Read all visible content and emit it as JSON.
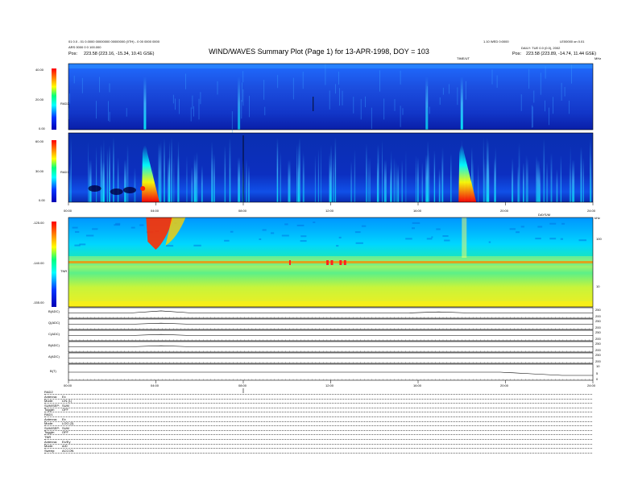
{
  "header": {
    "title": "WIND/WAVES Summary Plot (Page 1) for 13-APR-1998, DOY = 103",
    "left_line1": "01 0.0 - 01 0.0000 00000000 00000000 (0TH) - 0 00 0000 0000",
    "left_line2": "ARS 0000 0 0 100.000",
    "left_line3": "Pos:",
    "left_pos": "223.58 (223.16, -15.34, 10.41 GSE)",
    "right_line1": "1.10 WED 0:0000",
    "right_line2": "LE00000 on 0.01",
    "right_line3": "DAILY: TUE 0.0 (0.0), 2002",
    "right_line4": "Pos:",
    "right_pos": "223.58 (223.89, -14.74, 11.44 GSE)",
    "time_label": "TIME/UT"
  },
  "colors": {
    "background": "#0000b4",
    "low": "#0036ff",
    "mid": "#00ffff",
    "high": "#ffff00",
    "peak": "#ff0000",
    "tnr_base": "#00b9ff"
  },
  "panels": {
    "rad2": {
      "label": "RAD2",
      "ticks": [
        "40.00",
        "20.00",
        "0.00"
      ],
      "right_label": "MHz"
    },
    "rad1": {
      "label": "RAD1",
      "ticks": [
        "60.00",
        "30.00",
        "0.00"
      ]
    },
    "top_time_ticks": [
      "00:00",
      "04:00",
      "08:00",
      "12:00",
      "16:00",
      "20:00",
      "24:00"
    ],
    "tnr": {
      "label": "TNR",
      "ticks": [
        "-125.00",
        "-140.00",
        "-155.00"
      ],
      "right_ticks": [
        "100",
        "10"
      ],
      "right_label": "kHz"
    },
    "spectra_label_right": "DAYS/M"
  },
  "lineplots": {
    "labels": [
      "B(ADC)",
      "Q(ADC)",
      "C(ADC)",
      "B(ADC)",
      "A(ADC)",
      "B(T)"
    ],
    "right_ticks": [
      "250",
      "200",
      "250",
      "200",
      "250",
      "200",
      "250",
      "200",
      "250",
      "200",
      "10",
      "5",
      "0"
    ]
  },
  "bottom_time_ticks": [
    "00:00",
    "04:00",
    "08:00",
    "12:00",
    "16:00",
    "20:00",
    "24:00"
  ],
  "footer": {
    "rows": [
      [
        "RAD2",
        ""
      ],
      [
        "Antenna:",
        "Ex"
      ],
      [
        "Mode:",
        "LIN (1)"
      ],
      [
        "SUM/SEP:",
        "SUM"
      ],
      [
        "Toggle:",
        "OFF"
      ],
      [
        "RAD1",
        ""
      ],
      [
        "Antenna:",
        "Ex"
      ],
      [
        "Mode:",
        "LOG (3)"
      ],
      [
        "SUM/SEP:",
        "SUM"
      ],
      [
        "Toggle:",
        "OFF"
      ],
      [
        "TNR",
        ""
      ],
      [
        "Antenna:",
        "Ex/Ey"
      ],
      [
        "Mode:",
        "A/D"
      ],
      [
        "Sweep:",
        "ACCON"
      ]
    ]
  },
  "chart_data": [
    {
      "type": "heatmap",
      "name_hint": "RAD2",
      "xlabel": "",
      "ylabel": "RAD2",
      "xlim": [
        "00:00",
        "24:00"
      ],
      "ylim": [
        0,
        40
      ],
      "bursts_hours": [
        3.5,
        7.8,
        16.4,
        18.0
      ],
      "burst_intensity": [
        0.9,
        0.5,
        0.6,
        0.9
      ]
    },
    {
      "type": "heatmap",
      "name_hint": "RAD1",
      "xlabel": "",
      "ylabel": "RAD1",
      "xlim": [
        "00:00",
        "24:00"
      ],
      "ylim": [
        0,
        60
      ],
      "bursts_hours": [
        1.0,
        1.6,
        2.6,
        3.5,
        4.6,
        5.8,
        7.8,
        10.1,
        14.5,
        16.4,
        18.0,
        19.2,
        21.5,
        23.1
      ],
      "burst_intensity": [
        0.4,
        0.3,
        0.4,
        1.0,
        0.5,
        0.4,
        0.5,
        0.4,
        0.4,
        0.6,
        1.0,
        0.4,
        0.4,
        0.4
      ]
    },
    {
      "type": "heatmap",
      "name_hint": "TNR",
      "xlabel": "",
      "ylabel": "TNR",
      "xlim": [
        "00:00",
        "24:00"
      ],
      "ylim": [
        -155,
        -125
      ],
      "right_axis_kHz": [
        10,
        100
      ],
      "line_level": -140,
      "bursts_hours": [
        3.7,
        12.0,
        12.4,
        18.0
      ],
      "burst_intensity": [
        1.0,
        0.5,
        0.5,
        0.6
      ]
    },
    {
      "type": "line",
      "series": [
        {
          "name": "B(ADC)",
          "values": [
            0.5,
            0.5,
            0.5,
            0.7,
            0.5,
            0.5,
            0.5,
            0.5,
            0.5,
            0.5,
            0.5,
            0.5,
            0.6,
            0.5,
            0.5,
            0.5,
            0.5,
            0.5
          ]
        },
        {
          "name": "Q(ADC)",
          "values": [
            0.5,
            0.5,
            0.5,
            0.6,
            0.5,
            0.5,
            0.5,
            0.5,
            0.5,
            0.5,
            0.5,
            0.5,
            0.5,
            0.5,
            0.5,
            0.5,
            0.5,
            0.5
          ]
        },
        {
          "name": "C(ADC)",
          "values": [
            0.5,
            0.5,
            0.5,
            0.6,
            0.5,
            0.5,
            0.5,
            0.5,
            0.5,
            0.5,
            0.5,
            0.5,
            0.5,
            0.5,
            0.5,
            0.5,
            0.5,
            0.5
          ]
        },
        {
          "name": "B(ADC)",
          "values": [
            0.5,
            0.5,
            0.5,
            0.6,
            0.5,
            0.5,
            0.5,
            0.5,
            0.5,
            0.5,
            0.5,
            0.5,
            0.5,
            0.5,
            0.5,
            0.5,
            0.5,
            0.5
          ]
        },
        {
          "name": "A(ADC)",
          "values": [
            0.5,
            0.5,
            0.5,
            0.5,
            0.5,
            0.5,
            0.5,
            0.5,
            0.5,
            0.5,
            0.5,
            0.5,
            0.5,
            0.5,
            0.5,
            0.5,
            0.5,
            0.5
          ]
        },
        {
          "name": "B(T)",
          "values": [
            0.5,
            0.5,
            0.5,
            0.5,
            0.5,
            0.5,
            0.5,
            0.5,
            0.5,
            0.5,
            0.5,
            0.5,
            0.5,
            0.5,
            0.5,
            0.4,
            0.3,
            0.3
          ]
        }
      ]
    }
  ]
}
